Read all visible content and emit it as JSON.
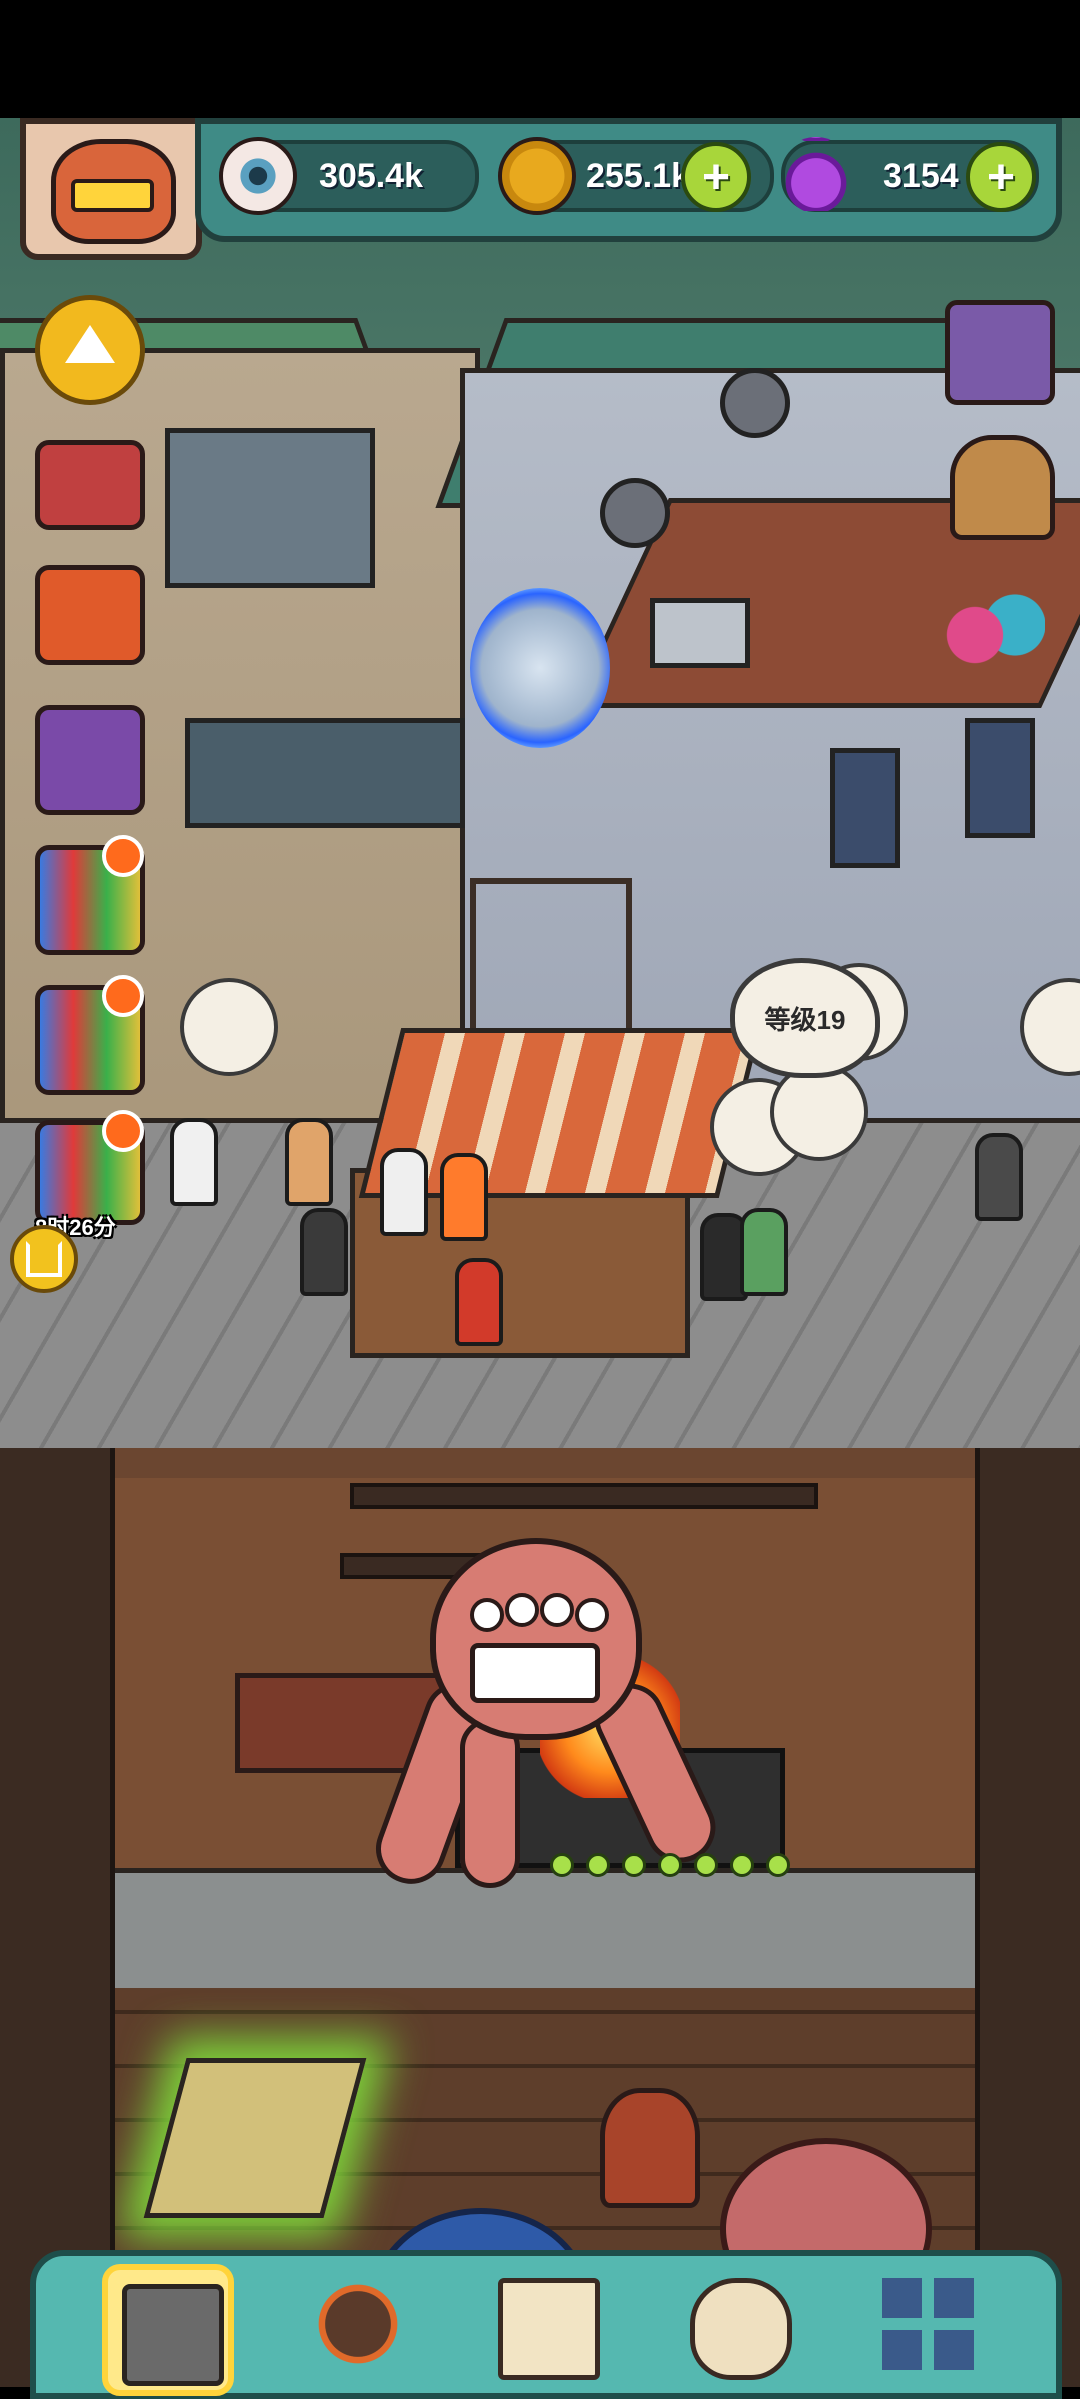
{
  "resources": {
    "eyeballs": "305.4k",
    "coins": "255.1k",
    "potions": "3154"
  },
  "icons": {
    "eyeball": "eyeball-icon",
    "coin": "coin-icon",
    "potion": "potion-icon",
    "plus": "plus-icon"
  },
  "plus_label": "+",
  "side_timer": "8时26分",
  "level_bubble": "等级19",
  "nav": {
    "items": [
      "building-icon",
      "monster-icon",
      "book-icon",
      "money-bag-icon",
      "grid-icon"
    ],
    "active_index": 0
  },
  "colors": {
    "accent": "#3f8b86",
    "plus": "#a8d63a",
    "nav_active": "#ffd43b"
  }
}
